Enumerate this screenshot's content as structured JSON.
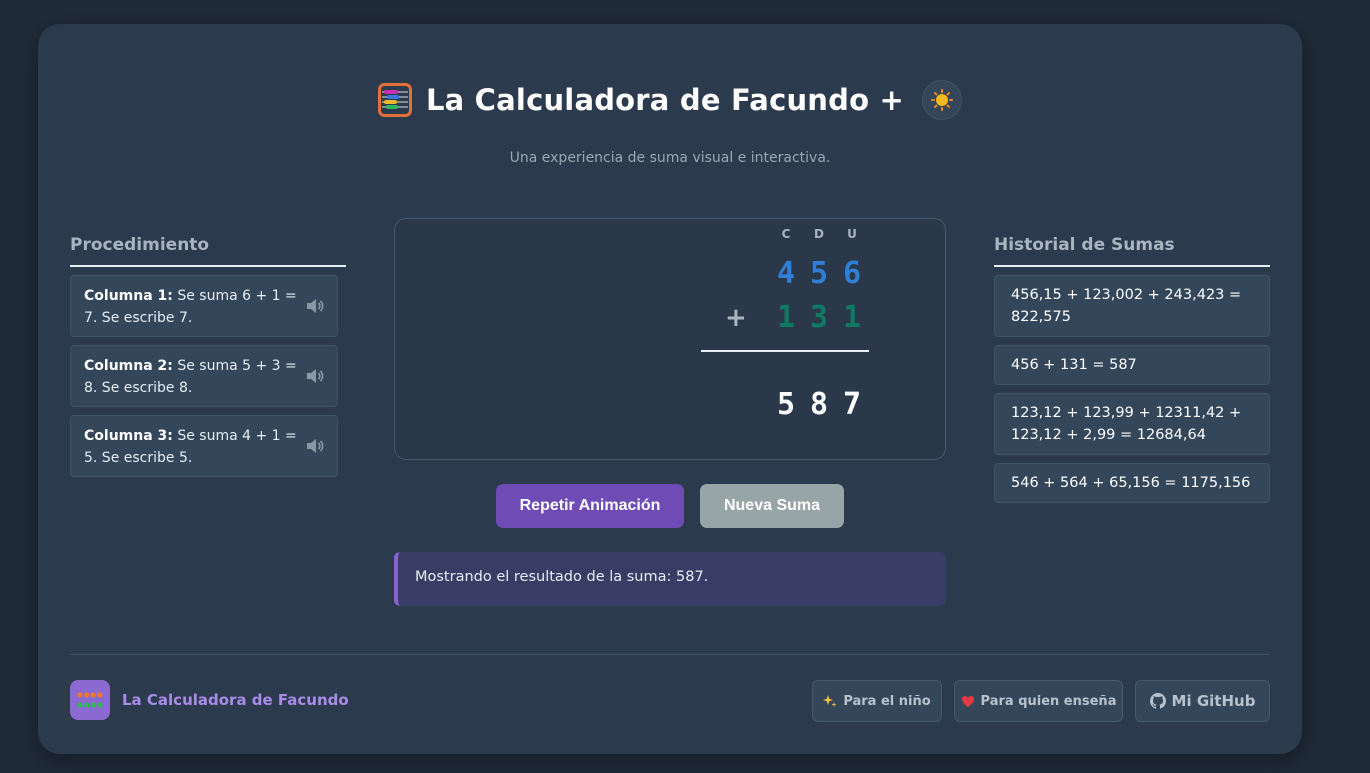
{
  "header": {
    "title": "La Calculadora de Facundo +",
    "subtitle": "Una experiencia de suma visual e interactiva.",
    "abacus_icon": "abacus-icon",
    "theme_icon": "sun-icon"
  },
  "procedure": {
    "title": "Procedimiento",
    "items": [
      {
        "label": "Columna 1:",
        "text": "Se suma 6 + 1 = 7. Se escribe 7."
      },
      {
        "label": "Columna 2:",
        "text": "Se suma 5 + 3 = 8. Se escribe 8."
      },
      {
        "label": "Columna 3:",
        "text": "Se suma 4 + 1 = 5. Se escribe 5."
      }
    ]
  },
  "board": {
    "places": [
      "C",
      "D",
      "U"
    ],
    "operand1": [
      "4",
      "5",
      "6"
    ],
    "operand2": [
      "1",
      "3",
      "1"
    ],
    "operator": "+",
    "result": [
      "5",
      "8",
      "7"
    ]
  },
  "buttons": {
    "repeat": "Repetir Animación",
    "new": "Nueva Suma"
  },
  "status": "Mostrando el resultado de la suma: 587.",
  "history": {
    "title": "Historial de Sumas",
    "items": [
      "456,15 + 123,002 + 243,423 = 822,575",
      "456 + 131 = 587",
      "123,12 + 123,99 + 12311,42 + 123,12 + 2,99 = 12684,64",
      "546 + 564 + 65,156 = 1175,156"
    ]
  },
  "footer": {
    "brand": "La Calculadora de Facundo",
    "links": [
      {
        "icon": "sparkles-icon",
        "label": "Para el niño"
      },
      {
        "icon": "heart-icon",
        "label": "Para quien enseña"
      },
      {
        "icon": "github-icon",
        "label": "Mi GitHub"
      }
    ]
  },
  "colors": {
    "accent": "#6f4bb5",
    "operand1": "#2f7fd6",
    "operand2": "#0f7a63"
  }
}
